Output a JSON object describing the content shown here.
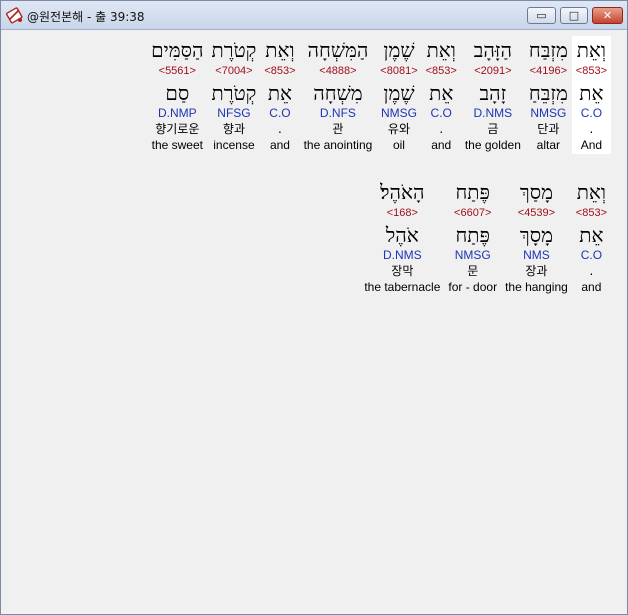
{
  "window": {
    "title": "@원전본해 - 출 39:38",
    "buttons": {
      "minimize": "▭",
      "maximize": "□",
      "close": "✕"
    }
  },
  "verse_rows": [
    {
      "words": [
        {
          "hebrew": "וְאֵת",
          "strong": "<853>",
          "lemma": "אֵת",
          "morph": "C.O",
          "korean": ".",
          "english": "And",
          "highlighted": true
        },
        {
          "hebrew": "מִזְבַּח",
          "strong": "<4196>",
          "lemma": "מִזְבֵּחַ",
          "morph": "NMSG",
          "korean": "단과",
          "english": "altar"
        },
        {
          "hebrew": "הַזָּהָב",
          "strong": "<2091>",
          "lemma": "זָהָב",
          "morph": "D.NMS",
          "korean": "금",
          "english": "the golden"
        },
        {
          "hebrew": "וְאֵת",
          "strong": "<853>",
          "lemma": "אֵת",
          "morph": "C.O",
          "korean": ".",
          "english": "and"
        },
        {
          "hebrew": "שֶׁמֶן",
          "strong": "<8081>",
          "lemma": "שֶׁמֶן",
          "morph": "NMSG",
          "korean": "유와",
          "english": "oil"
        },
        {
          "hebrew": "הַמִּשְׁחָה",
          "strong": "<4888>",
          "lemma": "מִשְׁחָה",
          "morph": "D.NFS",
          "korean": "관",
          "english": "the anointing"
        },
        {
          "hebrew": "וְאֵת",
          "strong": "<853>",
          "lemma": "אֵת",
          "morph": "C.O",
          "korean": ".",
          "english": "and"
        },
        {
          "hebrew": "קְטֹרֶת",
          "strong": "<7004>",
          "lemma": "קְטֹרֶת",
          "morph": "NFSG",
          "korean": "향과",
          "english": "incense"
        },
        {
          "hebrew": "הַסַּמִּים",
          "strong": "<5561>",
          "lemma": "סַם",
          "morph": "D.NMP",
          "korean": "향기로운",
          "english": "the sweet"
        }
      ]
    },
    {
      "words": [
        {
          "hebrew": "וְאֵת",
          "strong": "<853>",
          "lemma": "אֵת",
          "morph": "C.O",
          "korean": ".",
          "english": "and"
        },
        {
          "hebrew": "מָסַךְ",
          "strong": "<4539>",
          "lemma": "מָסָךְ",
          "morph": "NMS",
          "korean": "장과",
          "english": "the hanging"
        },
        {
          "hebrew": "פֶּתַח",
          "strong": "<6607>",
          "lemma": "פֶּתַח",
          "morph": "NMSG",
          "korean": "문",
          "english": "for - door"
        },
        {
          "hebrew": "הָאֹהֶל׃",
          "strong": "<168>",
          "lemma": "אֹהֶל",
          "morph": "D.NMS",
          "korean": "장막",
          "english": "the tabernacle"
        }
      ]
    }
  ],
  "colors": {
    "strong": "#a0101a",
    "morph": "#1b35b5",
    "highlight": "#ffffff"
  }
}
